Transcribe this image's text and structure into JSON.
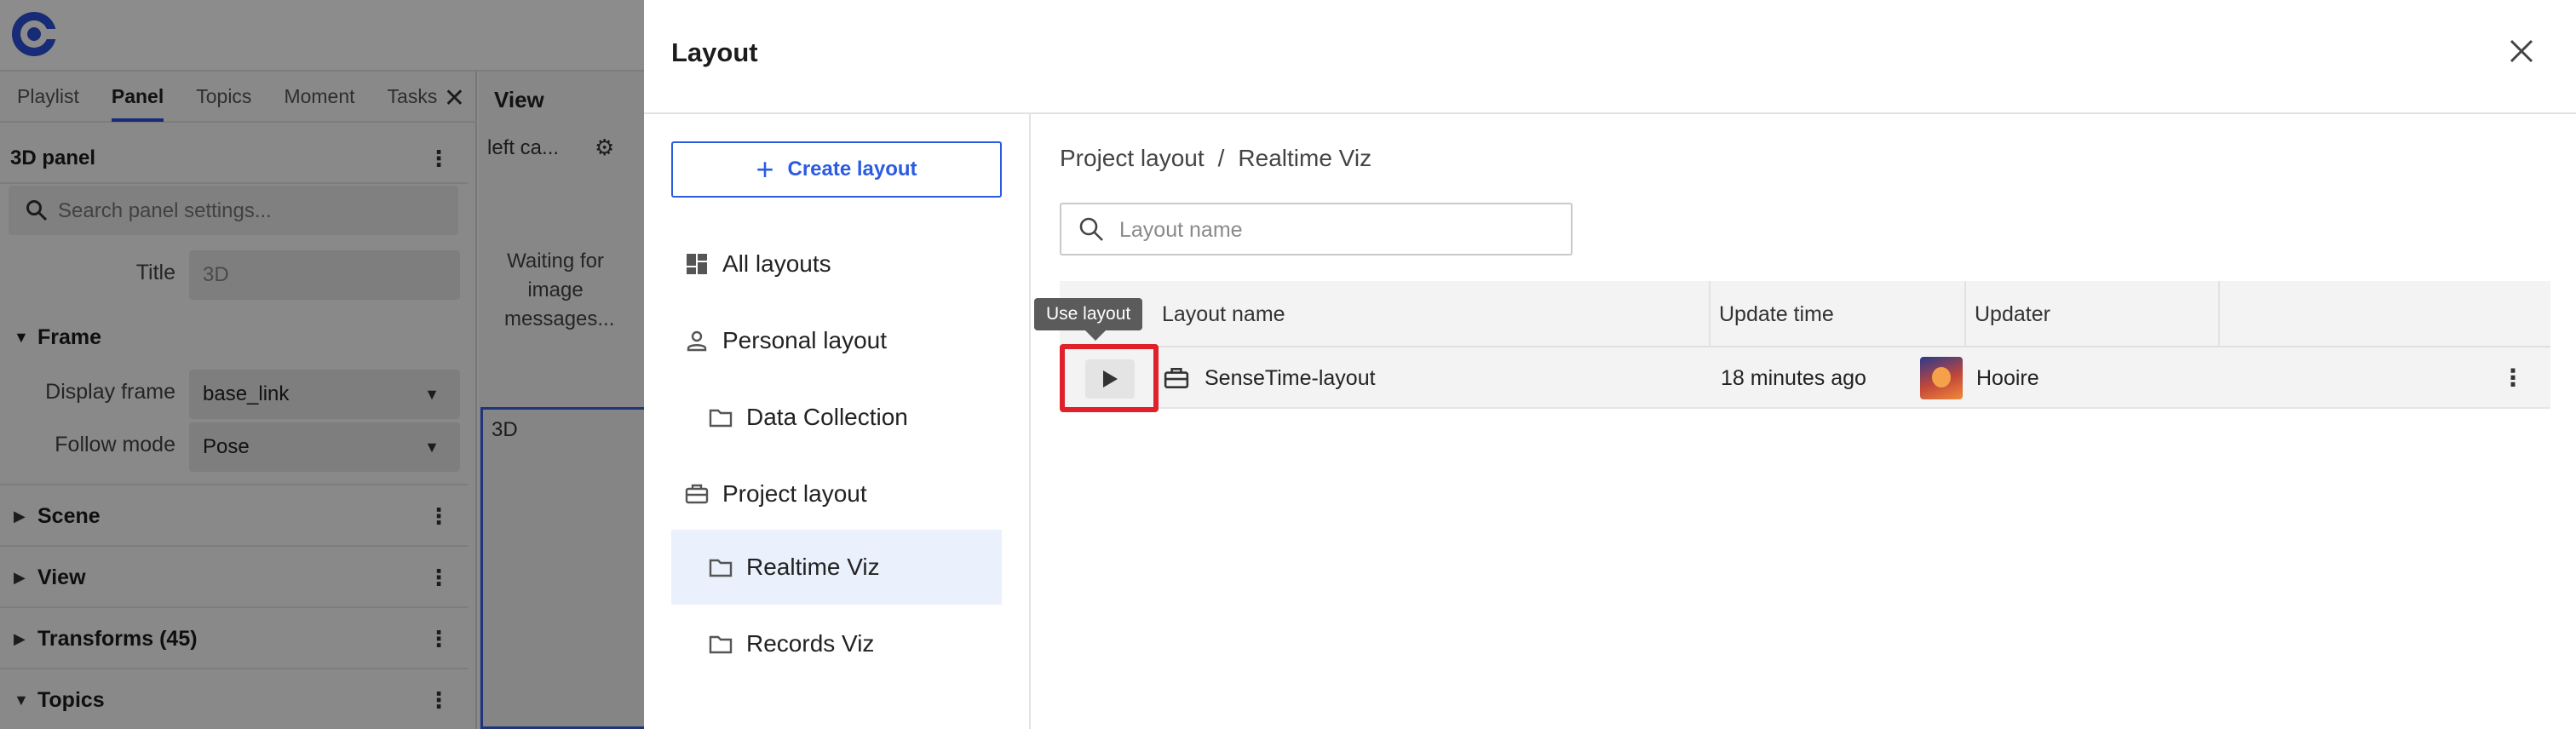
{
  "app": {
    "tabs": [
      "Playlist",
      "Panel",
      "Topics",
      "Moment",
      "Tasks"
    ],
    "active_tab": "Panel",
    "panel_title": "3D panel",
    "search_placeholder": "Search panel settings...",
    "title_label": "Title",
    "title_value": "3D",
    "frame_section": "Frame",
    "display_frame_label": "Display frame",
    "display_frame_value": "base_link",
    "follow_mode_label": "Follow mode",
    "follow_mode_value": "Pose",
    "sections": [
      "Scene",
      "View",
      "Transforms (45)",
      "Topics"
    ],
    "view_header": "View",
    "left_camera": "left ca...",
    "waiting_text": "Waiting for image messages...",
    "viewport_label": "3D"
  },
  "drawer": {
    "title": "Layout",
    "create_label": "Create layout",
    "nav": [
      {
        "label": "All layouts",
        "icon": "dashboard-icon"
      },
      {
        "label": "Personal layout",
        "icon": "person-icon"
      },
      {
        "label": "Data Collection",
        "icon": "folder-icon"
      },
      {
        "label": "Project layout",
        "icon": "briefcase-icon"
      },
      {
        "label": "Realtime Viz",
        "icon": "folder-icon"
      },
      {
        "label": "Records Viz",
        "icon": "folder-icon"
      }
    ],
    "selected_nav": "Realtime Viz",
    "breadcrumb": [
      "Project layout",
      "Realtime Viz"
    ],
    "breadcrumb_sep": "/",
    "search_placeholder": "Layout name",
    "columns": [
      "Layout name",
      "Update time",
      "Updater"
    ],
    "rows": [
      {
        "name": "SenseTime-layout",
        "update_time": "18 minutes ago",
        "updater": "Hooire"
      }
    ],
    "tooltip": "Use layout",
    "colors": {
      "accent": "#2b5be0",
      "highlight": "#e0202a",
      "selected_bg": "#eaf0fc"
    }
  }
}
